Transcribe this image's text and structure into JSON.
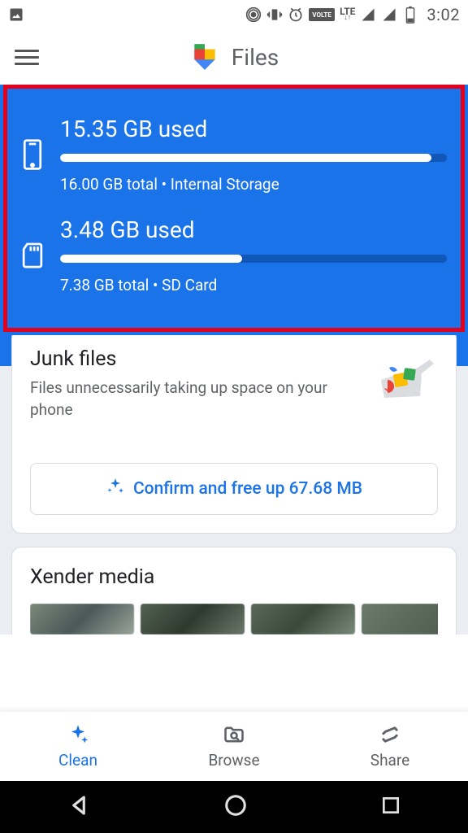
{
  "status_bar": {
    "clock": "3:02"
  },
  "header": {
    "title": "Files"
  },
  "storage": {
    "internal": {
      "used_label": "15.35 GB used",
      "total_label": "16.00 GB total • Internal Storage",
      "percent": 96
    },
    "sd": {
      "used_label": "3.48 GB used",
      "total_label": "7.38 GB total • SD Card",
      "percent": 47
    }
  },
  "junk_card": {
    "title": "Junk files",
    "desc": "Files unnecessarily taking up space on your phone",
    "button": "Confirm and free up 67.68 MB"
  },
  "xender_card": {
    "title": "Xender media"
  },
  "nav": {
    "clean": "Clean",
    "browse": "Browse",
    "share": "Share"
  }
}
